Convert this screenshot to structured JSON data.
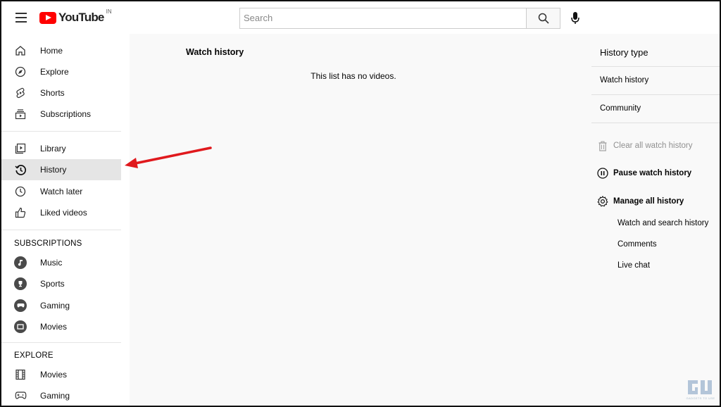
{
  "header": {
    "logo_text": "YouTube",
    "logo_country": "IN",
    "search_placeholder": "Search"
  },
  "sidebar": {
    "main_items": [
      {
        "label": "Home",
        "icon": "home-icon"
      },
      {
        "label": "Explore",
        "icon": "compass-icon"
      },
      {
        "label": "Shorts",
        "icon": "shorts-icon"
      },
      {
        "label": "Subscriptions",
        "icon": "subscriptions-icon"
      }
    ],
    "library_items": [
      {
        "label": "Library",
        "icon": "library-icon"
      },
      {
        "label": "History",
        "icon": "history-icon",
        "active": true
      },
      {
        "label": "Watch later",
        "icon": "clock-icon"
      },
      {
        "label": "Liked videos",
        "icon": "thumbs-up-icon"
      }
    ],
    "subscriptions_title": "SUBSCRIPTIONS",
    "subscriptions": [
      {
        "label": "Music",
        "icon": "music-note-icon"
      },
      {
        "label": "Sports",
        "icon": "trophy-icon"
      },
      {
        "label": "Gaming",
        "icon": "gamepad-icon"
      },
      {
        "label": "Movies",
        "icon": "film-icon"
      }
    ],
    "explore_title": "EXPLORE",
    "explore": [
      {
        "label": "Movies",
        "icon": "film-strip-icon"
      },
      {
        "label": "Gaming",
        "icon": "gamepad-icon"
      }
    ]
  },
  "main": {
    "title": "Watch history",
    "empty_message": "This list has no videos."
  },
  "right_panel": {
    "title": "History type",
    "options": [
      "Watch history",
      "Community"
    ],
    "clear_label": "Clear all watch history",
    "pause_label": "Pause watch history",
    "manage_label": "Manage all history",
    "manage_sub": [
      "Watch and search history",
      "Comments",
      "Live chat"
    ]
  },
  "colors": {
    "brand_red": "#ff0000",
    "arrow_red": "#e0191d",
    "active_bg": "#e5e5e5"
  },
  "watermark": {
    "text": "GADGETS TO USE"
  }
}
